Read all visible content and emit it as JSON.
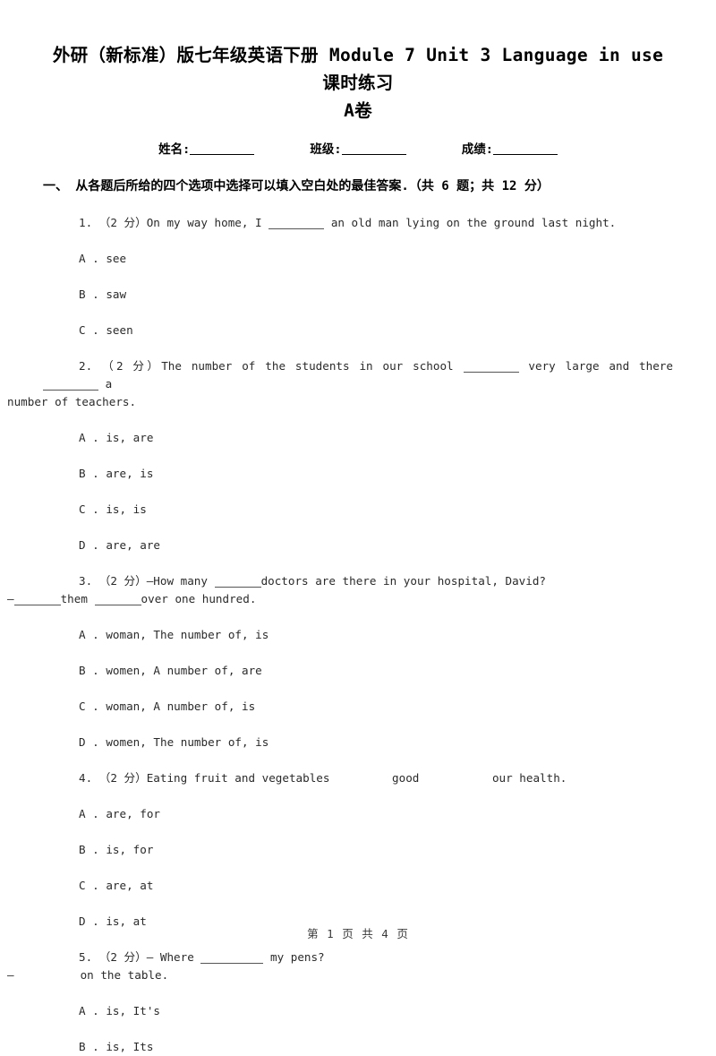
{
  "document": {
    "title_line1": "外研（新标准）版七年级英语下册 Module 7 Unit 3 Language in use 课时练习",
    "title_line2": "A卷",
    "student_info": [
      {
        "label": "姓名:"
      },
      {
        "label": "班级:"
      },
      {
        "label": "成绩:"
      }
    ],
    "footer": "第 1 页 共 4 页"
  },
  "section": {
    "heading": "一、 从各题后所给的四个选项中选择可以填入空白处的最佳答案.（共 6 题；共 12 分）"
  },
  "questions": [
    {
      "number": "1.",
      "points": "（2 分）",
      "stem_before": "On my way home, I",
      "stem_after": "an old man lying on the ground last night.",
      "options": [
        {
          "letter": "A .",
          "text": "see"
        },
        {
          "letter": "B .",
          "text": "saw"
        },
        {
          "letter": "C .",
          "text": "seen"
        }
      ]
    },
    {
      "number": "2.",
      "points": "（2 分）",
      "stem_before": "The number of the students in our school",
      "stem_mid": "very large and there",
      "stem_after": "a",
      "stem_wrap": "number of teachers.",
      "options": [
        {
          "letter": "A .",
          "text": "is, are"
        },
        {
          "letter": "B .",
          "text": "are, is"
        },
        {
          "letter": "C .",
          "text": "is, is"
        },
        {
          "letter": "D .",
          "text": "are, are"
        }
      ]
    },
    {
      "number": "3.",
      "points": "（2 分）",
      "stem_before": "—How many",
      "stem_after": "doctors are there in your hospital, David?",
      "answer_dash": "—",
      "answer_mid": "them",
      "answer_end": "over one hundred.",
      "options": [
        {
          "letter": "A .",
          "text": "woman, The number of, is"
        },
        {
          "letter": "B .",
          "text": "women, A number of, are"
        },
        {
          "letter": "C .",
          "text": "woman, A number of, is"
        },
        {
          "letter": "D .",
          "text": "women, The number of, is"
        }
      ]
    },
    {
      "number": "4.",
      "points": "（2 分）",
      "stem_before": "Eating fruit and vegetables",
      "stem_mid": "good",
      "stem_after": "our health.",
      "options": [
        {
          "letter": "A .",
          "text": "are, for"
        },
        {
          "letter": "B .",
          "text": "is, for"
        },
        {
          "letter": "C .",
          "text": "are, at"
        },
        {
          "letter": "D .",
          "text": "is, at"
        }
      ]
    },
    {
      "number": "5.",
      "points": "（2 分）",
      "stem_before": "— Where",
      "stem_after": "my pens?",
      "answer_dash": "—",
      "answer_end": "on the table.",
      "options": [
        {
          "letter": "A .",
          "text": "is, It's"
        },
        {
          "letter": "B .",
          "text": "is, Its"
        }
      ]
    }
  ]
}
